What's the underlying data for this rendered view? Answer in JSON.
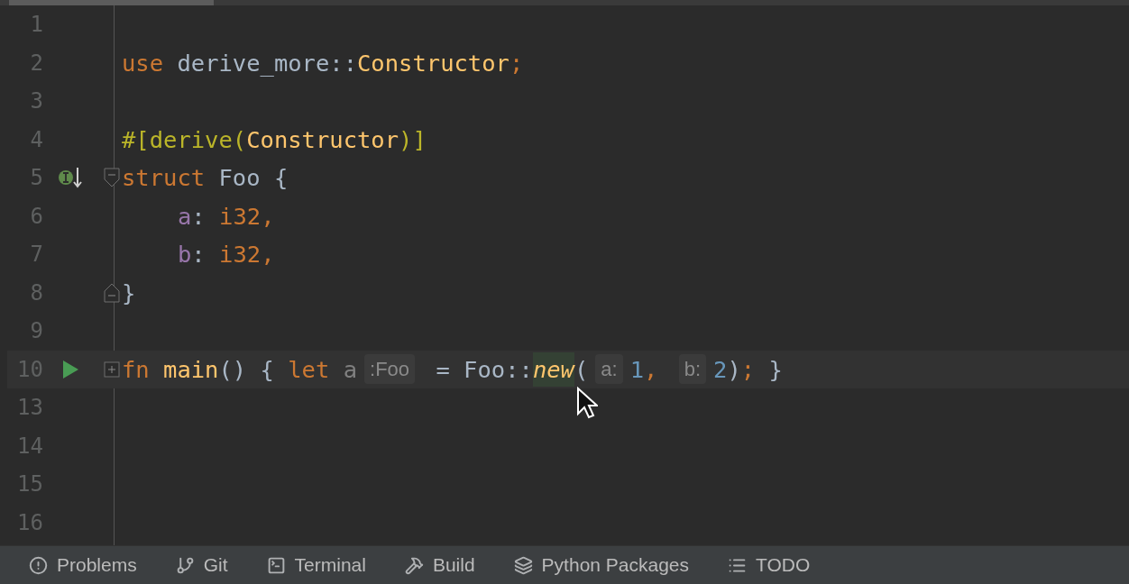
{
  "editor": {
    "lines": [
      {
        "number": "1",
        "current": false
      },
      {
        "number": "2",
        "current": false,
        "tokens": [
          {
            "text": "use ",
            "kind": "keyword"
          },
          {
            "text": "derive_more::",
            "kind": "plain"
          },
          {
            "text": "Constructor",
            "kind": "type"
          },
          {
            "text": ";",
            "kind": "keyword"
          }
        ]
      },
      {
        "number": "3",
        "current": false
      },
      {
        "number": "4",
        "current": false,
        "tokens": [
          {
            "text": "#[derive(",
            "kind": "attr"
          },
          {
            "text": "Constructor",
            "kind": "type"
          },
          {
            "text": ")]",
            "kind": "attr"
          }
        ]
      },
      {
        "number": "5",
        "current": false,
        "marker": {
          "kind": "implements"
        },
        "fold": {
          "kind": "start"
        },
        "tokens": [
          {
            "text": "struct ",
            "kind": "keyword"
          },
          {
            "text": "Foo {",
            "kind": "plain"
          }
        ]
      },
      {
        "number": "6",
        "current": false,
        "indented": true,
        "tokens": [
          {
            "text": "a",
            "kind": "field"
          },
          {
            "text": ": ",
            "kind": "plain"
          },
          {
            "text": "i32,",
            "kind": "keyword"
          }
        ]
      },
      {
        "number": "7",
        "current": false,
        "indented": true,
        "tokens": [
          {
            "text": "b",
            "kind": "field"
          },
          {
            "text": ": ",
            "kind": "plain"
          },
          {
            "text": "i32,",
            "kind": "keyword"
          }
        ]
      },
      {
        "number": "8",
        "current": false,
        "fold": {
          "kind": "end"
        },
        "tokens": [
          {
            "text": "}",
            "kind": "plain"
          }
        ]
      },
      {
        "number": "9",
        "current": false
      },
      {
        "number": "10",
        "current": true,
        "marker": {
          "kind": "run"
        },
        "fold": {
          "kind": "collapsed"
        },
        "tokens": [
          {
            "text": "fn ",
            "kind": "keyword"
          },
          {
            "text": "main",
            "kind": "function"
          },
          {
            "text": "() { ",
            "kind": "plain"
          },
          {
            "text": "let ",
            "kind": "keyword"
          },
          {
            "text": "a",
            "kind": "unused"
          },
          {
            "text": ":Foo",
            "kind": "hint"
          },
          {
            "text": " = Foo::",
            "kind": "plain"
          },
          {
            "text": "new",
            "kind": "usage"
          },
          {
            "text": "(",
            "kind": "plain"
          },
          {
            "text": "a:",
            "kind": "hint"
          },
          {
            "text": "1",
            "kind": "number"
          },
          {
            "text": ", ",
            "kind": "keyword"
          },
          {
            "text": "b:",
            "kind": "hint"
          },
          {
            "text": "2",
            "kind": "number"
          },
          {
            "text": ")",
            "kind": "plain"
          },
          {
            "text": ";",
            "kind": "keyword"
          },
          {
            "text": " }",
            "kind": "plain"
          }
        ]
      },
      {
        "number": "13",
        "current": false
      },
      {
        "number": "14",
        "current": false
      },
      {
        "number": "15",
        "current": false
      },
      {
        "number": "16",
        "current": false
      }
    ]
  },
  "tool_window_bar": [
    {
      "label": "Problems"
    },
    {
      "label": "Git"
    },
    {
      "label": "Terminal"
    },
    {
      "label": "Build"
    },
    {
      "label": "Python Packages"
    },
    {
      "label": "TODO"
    }
  ]
}
